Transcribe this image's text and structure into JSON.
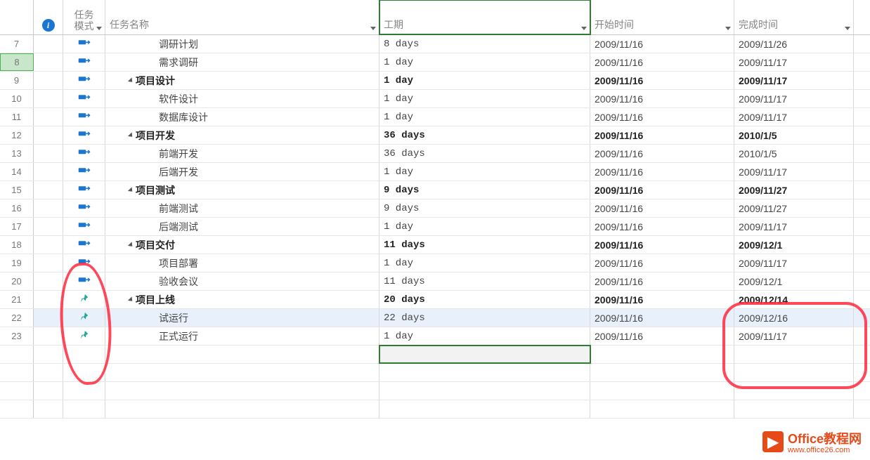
{
  "columns": {
    "info_icon": "i",
    "mode": "任务\n模式",
    "name": "任务名称",
    "duration": "工期",
    "start": "开始时间",
    "end": "完成时间"
  },
  "rows": [
    {
      "num": "7",
      "mode": "auto",
      "indent": 2,
      "summary": false,
      "name": "调研计划",
      "dur": "8 days",
      "start": "2009/11/16",
      "end": "2009/11/26"
    },
    {
      "num": "8",
      "mode": "auto",
      "indent": 2,
      "summary": false,
      "name": "需求调研",
      "dur": "1 day",
      "start": "2009/11/16",
      "end": "2009/11/17",
      "rowsel": true
    },
    {
      "num": "9",
      "mode": "auto",
      "indent": 1,
      "summary": true,
      "name": "项目设计",
      "dur": "1 day",
      "start": "2009/11/16",
      "end": "2009/11/17"
    },
    {
      "num": "10",
      "mode": "auto",
      "indent": 2,
      "summary": false,
      "name": "软件设计",
      "dur": "1 day",
      "start": "2009/11/16",
      "end": "2009/11/17"
    },
    {
      "num": "11",
      "mode": "auto",
      "indent": 2,
      "summary": false,
      "name": "数据库设计",
      "dur": "1 day",
      "start": "2009/11/16",
      "end": "2009/11/17"
    },
    {
      "num": "12",
      "mode": "auto",
      "indent": 1,
      "summary": true,
      "name": "项目开发",
      "dur": "36 days",
      "start": "2009/11/16",
      "end": "2010/1/5"
    },
    {
      "num": "13",
      "mode": "auto",
      "indent": 2,
      "summary": false,
      "name": "前端开发",
      "dur": "36 days",
      "start": "2009/11/16",
      "end": "2010/1/5"
    },
    {
      "num": "14",
      "mode": "auto",
      "indent": 2,
      "summary": false,
      "name": "后端开发",
      "dur": "1 day",
      "start": "2009/11/16",
      "end": "2009/11/17"
    },
    {
      "num": "15",
      "mode": "auto",
      "indent": 1,
      "summary": true,
      "name": "项目测试",
      "dur": "9 days",
      "start": "2009/11/16",
      "end": "2009/11/27"
    },
    {
      "num": "16",
      "mode": "auto",
      "indent": 2,
      "summary": false,
      "name": "前端测试",
      "dur": "9 days",
      "start": "2009/11/16",
      "end": "2009/11/27"
    },
    {
      "num": "17",
      "mode": "auto",
      "indent": 2,
      "summary": false,
      "name": "后端测试",
      "dur": "1 day",
      "start": "2009/11/16",
      "end": "2009/11/17"
    },
    {
      "num": "18",
      "mode": "auto",
      "indent": 1,
      "summary": true,
      "name": "项目交付",
      "dur": "11 days",
      "start": "2009/11/16",
      "end": "2009/12/1"
    },
    {
      "num": "19",
      "mode": "auto",
      "indent": 2,
      "summary": false,
      "name": "项目部署",
      "dur": "1 day",
      "start": "2009/11/16",
      "end": "2009/11/17"
    },
    {
      "num": "20",
      "mode": "auto",
      "indent": 2,
      "summary": false,
      "name": "验收会议",
      "dur": "11 days",
      "start": "2009/11/16",
      "end": "2009/12/1"
    },
    {
      "num": "21",
      "mode": "pin",
      "indent": 1,
      "summary": true,
      "name": "项目上线",
      "dur": "20 days",
      "start": "2009/11/16",
      "end": "2009/12/14"
    },
    {
      "num": "22",
      "mode": "pin",
      "indent": 2,
      "summary": false,
      "name": "试运行",
      "dur": "22 days",
      "start": "2009/11/16",
      "end": "2009/12/16",
      "highlight": true
    },
    {
      "num": "23",
      "mode": "pin",
      "indent": 2,
      "summary": false,
      "name": "正式运行",
      "dur": "1 day",
      "start": "2009/11/16",
      "end": "2009/11/17"
    }
  ],
  "watermark": {
    "title_a": "Office",
    "title_b": "教程网",
    "url": "www.office26.com"
  }
}
